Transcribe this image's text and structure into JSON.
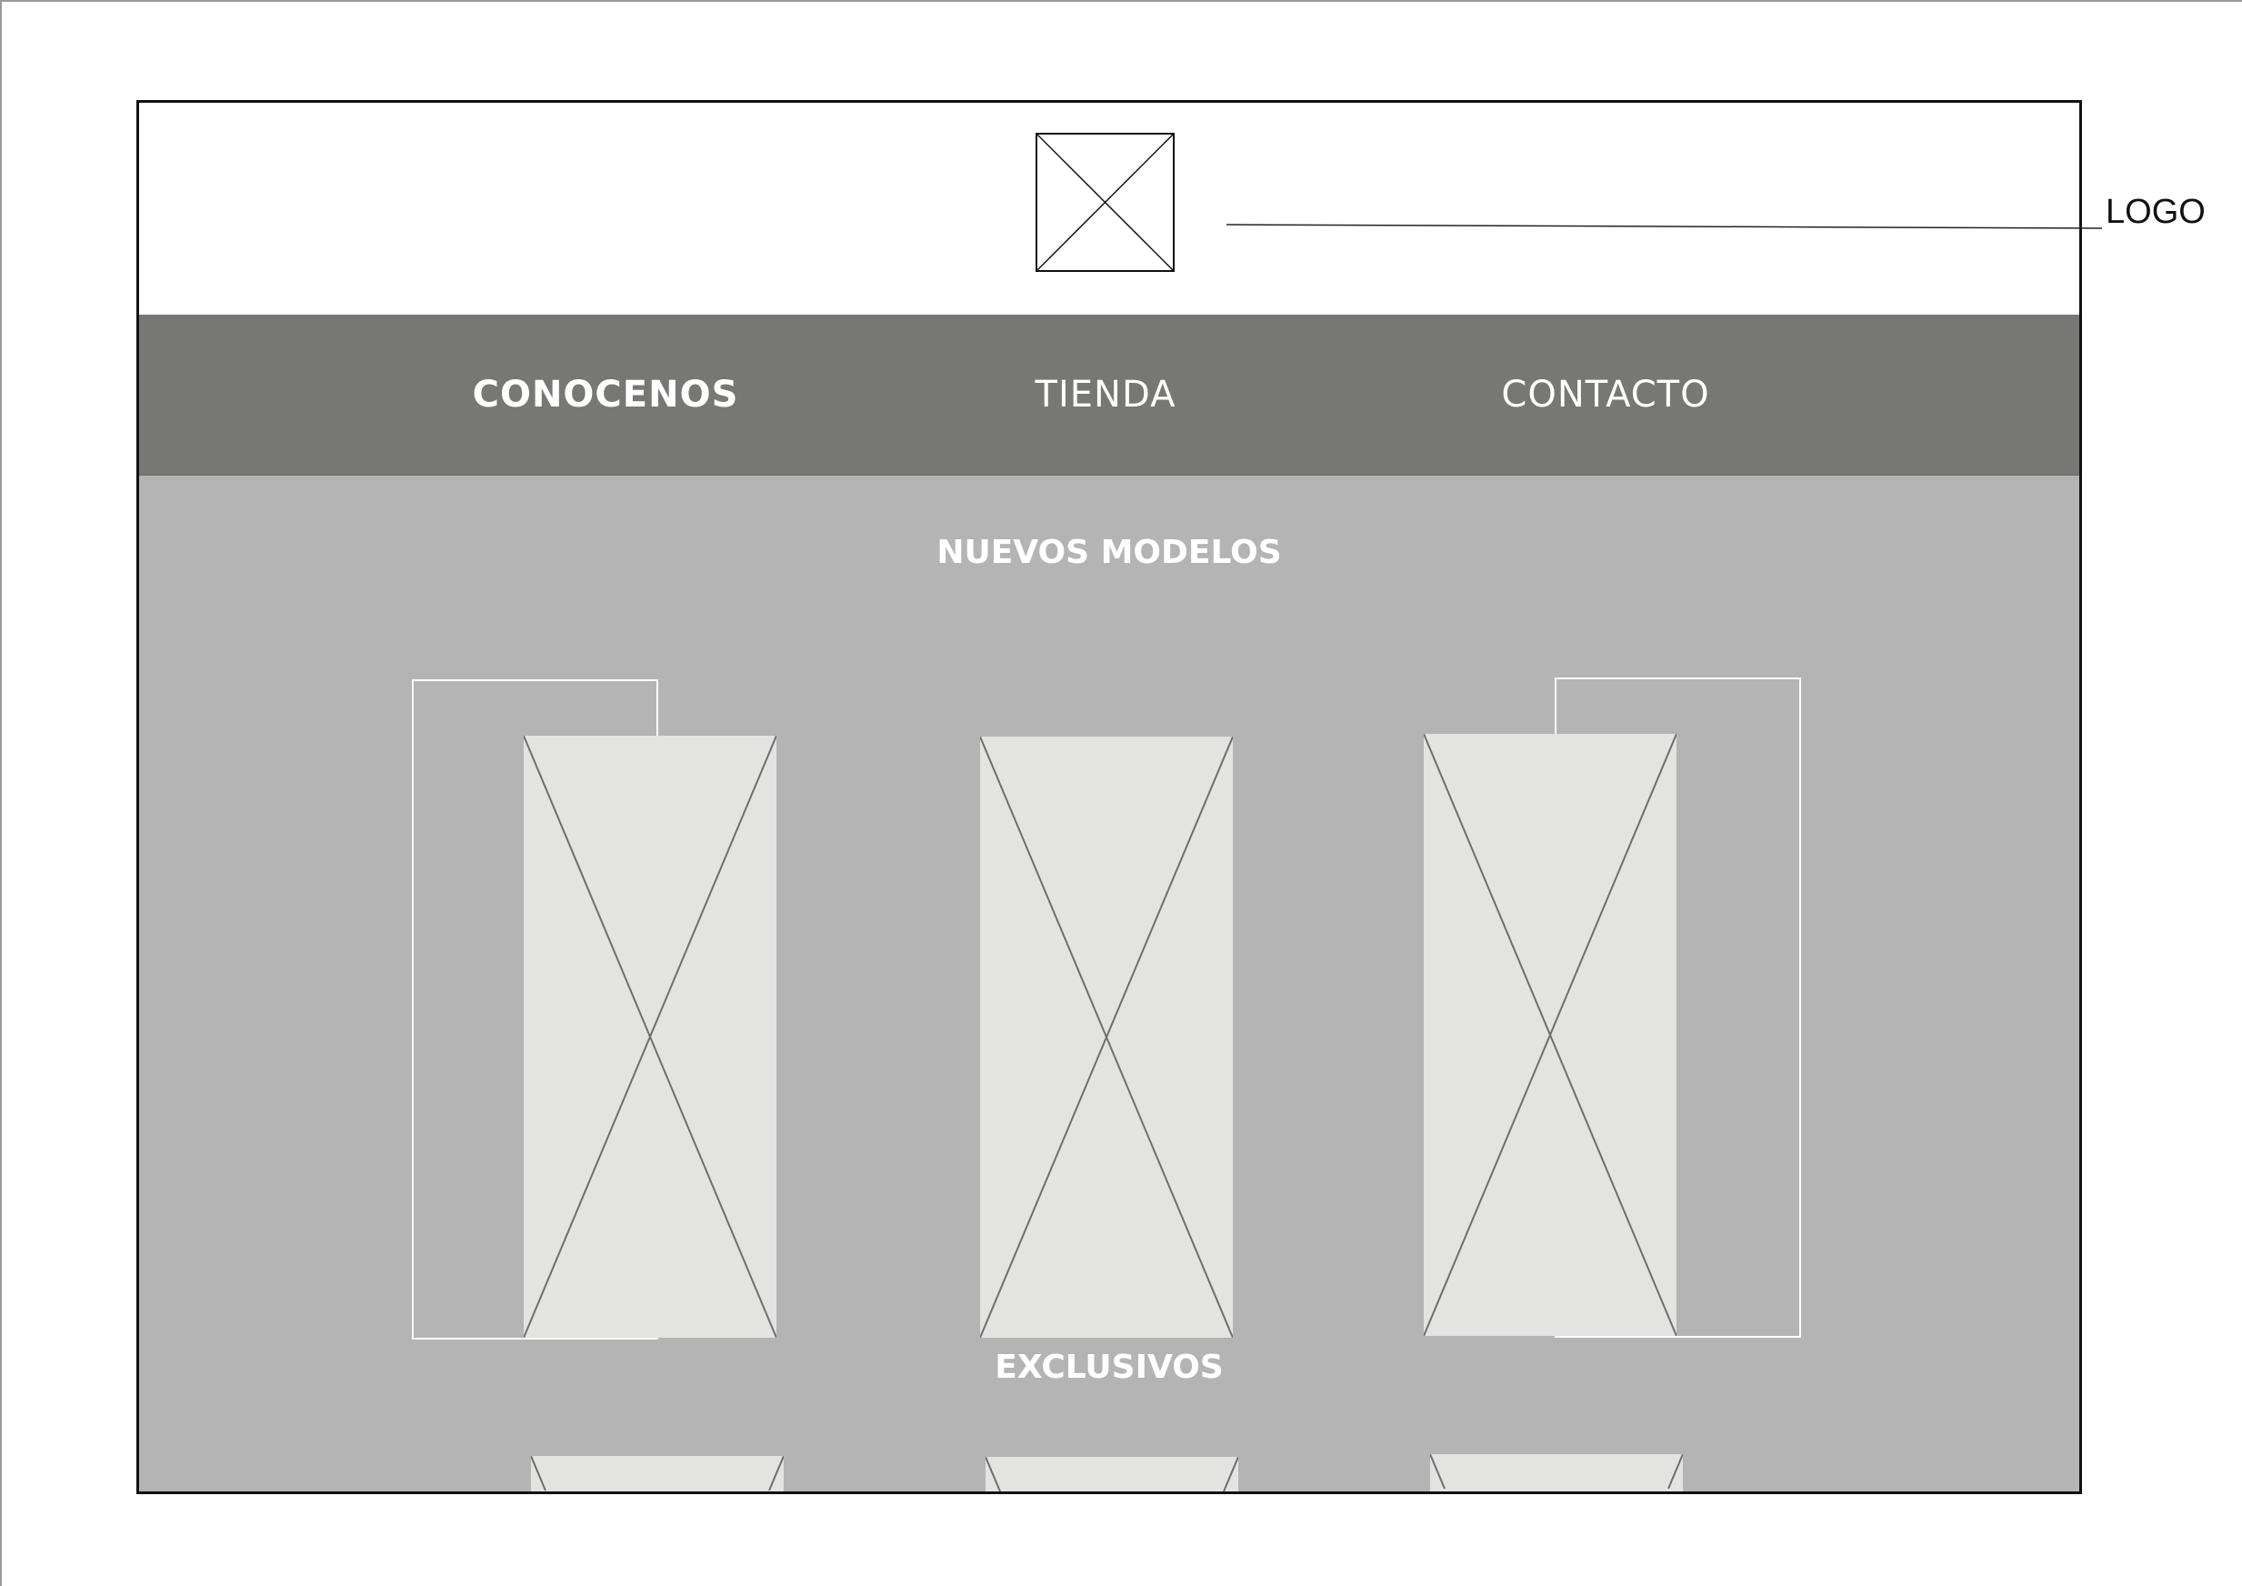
{
  "annotation": {
    "logo_label": "LOGO"
  },
  "nav": {
    "items": [
      {
        "label": "CONOCENOS",
        "active": true
      },
      {
        "label": "TIENDA",
        "active": false
      },
      {
        "label": "CONTACTO",
        "active": false
      }
    ]
  },
  "sections": {
    "new_models_title": "NUEVOS MODELOS",
    "exclusives_title": "EXCLUSIVOS"
  },
  "colors": {
    "navbar": "#777775",
    "content": "#b4b4b4",
    "placeholder": "#e3e3e2"
  }
}
